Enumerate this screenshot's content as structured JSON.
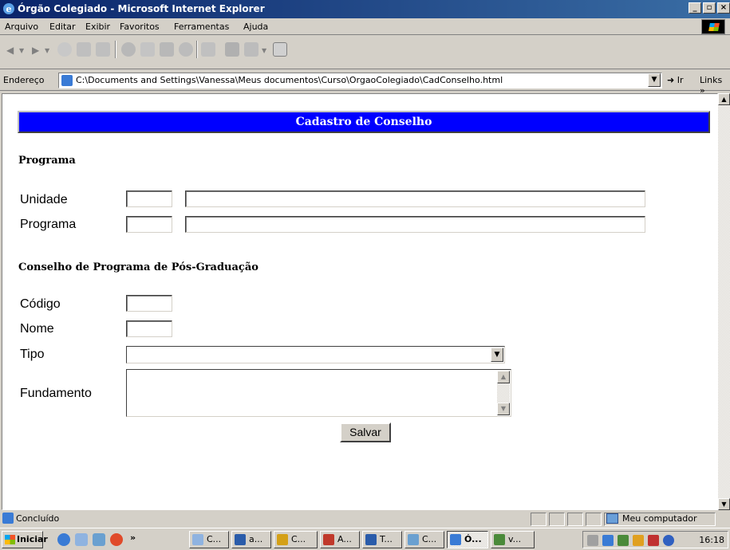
{
  "window": {
    "title": "Órgão Colegiado - Microsoft Internet Explorer"
  },
  "menu": [
    "Arquivo",
    "Editar",
    "Exibir",
    "Favoritos",
    "Ferramentas",
    "Ajuda"
  ],
  "address": {
    "label": "Endereço",
    "url": "C:\\Documents and Settings\\Vanessa\\Meus documentos\\Curso\\OrgaoColegiado\\CadConselho.html",
    "go_label": "Ir",
    "links_label": "Links"
  },
  "page": {
    "header": "Cadastro de Conselho",
    "section_programa": "Programa",
    "label_unidade": "Unidade",
    "label_programa": "Programa",
    "section_conselho": "Conselho de Programa de Pós-Graduação",
    "label_codigo": "Código",
    "label_nome": "Nome",
    "label_tipo": "Tipo",
    "label_fundamento": "Fundamento",
    "save_label": "Salvar"
  },
  "status": {
    "text": "Concluído",
    "zone": "Meu computador"
  },
  "taskbar": {
    "start_label": "Iniciar",
    "chevron": "»",
    "buttons": [
      "C...",
      "a...",
      "C...",
      "A...",
      "T...",
      "C...",
      "Ó...",
      "v..."
    ],
    "clock": "16:18"
  },
  "colors": {
    "header_bg": "#0000ff",
    "titlebar": "#0a246a",
    "face": "#d4d0c8"
  }
}
